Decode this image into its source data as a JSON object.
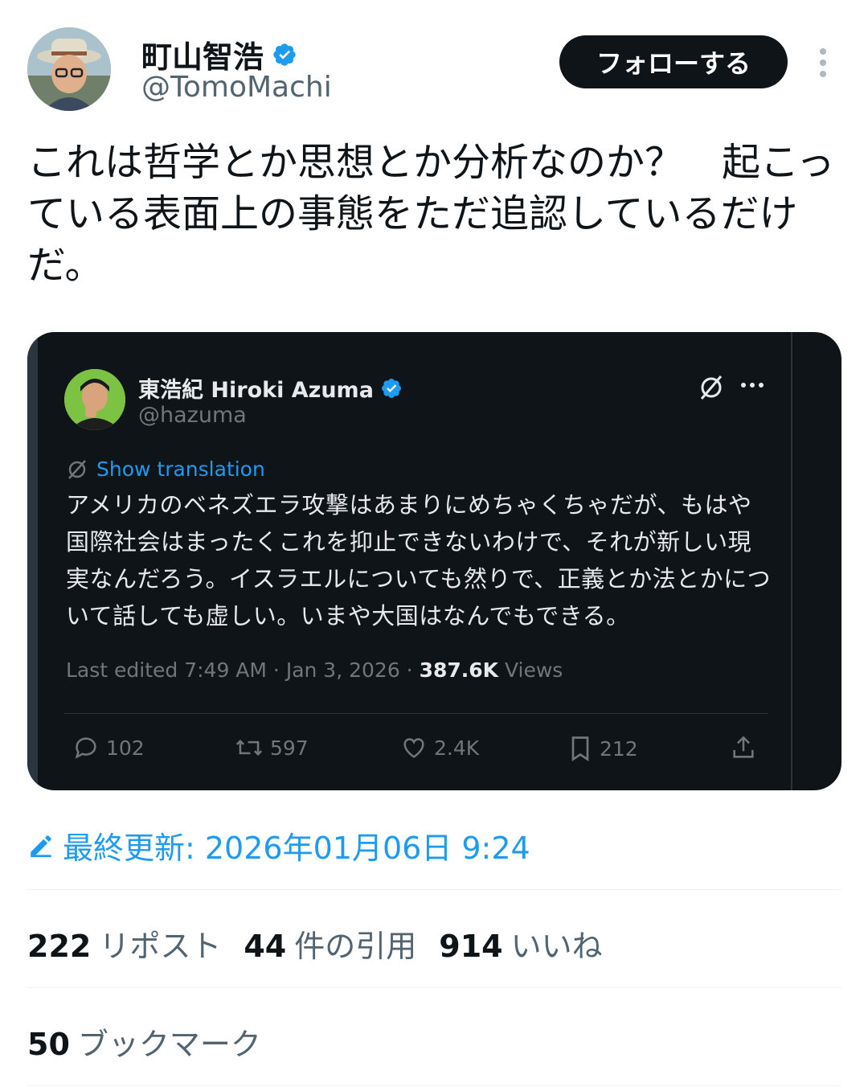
{
  "author": {
    "name": "町山智浩",
    "handle": "@TomoMachi",
    "follow_label": "フォローする"
  },
  "tweet": {
    "text": "これは哲学とか思想とか分析なのか？　起こっている表面上の事態をただ追認しているだけだ。"
  },
  "quote": {
    "name": "東浩紀 Hiroki Azuma",
    "handle": "@hazuma",
    "show_translation": "Show translation",
    "text": "アメリカのベネズエラ攻撃はあまりにめちゃくちゃだが、もはや国際社会はまったくこれを抑止できないわけで、それが新しい現実なんだろう。イスラエルについても然りで、正義とか法とかについて話しても虚しい。いまや大国はなんでもできる。",
    "meta_prefix": "Last edited 7:49 AM · Jan 3, 2026 · ",
    "views_count": "387.6K",
    "views_label": "Views",
    "actions": {
      "replies": "102",
      "reposts": "597",
      "likes": "2.4K",
      "bookmarks": "212"
    }
  },
  "edited": {
    "label": "最終更新: 2026年01月06日 9:24"
  },
  "stats": {
    "reposts_count": "222",
    "reposts_label": "リポスト",
    "quotes_count": "44",
    "quotes_label": "件の引用",
    "likes_count": "914",
    "likes_label": "いいね",
    "bookmarks_count": "50",
    "bookmarks_label": "ブックマーク"
  },
  "colors": {
    "accent": "#1d9bf0",
    "verified": "#1d9bf0",
    "card_bg": "#0f1419",
    "text_primary": "#0f1419",
    "text_secondary": "#536471"
  },
  "icons": [
    "verified-badge-icon",
    "more-vertical-icon",
    "grok-icon",
    "more-horizontal-icon",
    "translate-icon",
    "reply-icon",
    "repost-icon",
    "like-icon",
    "bookmark-icon",
    "share-icon",
    "edit-icon"
  ]
}
